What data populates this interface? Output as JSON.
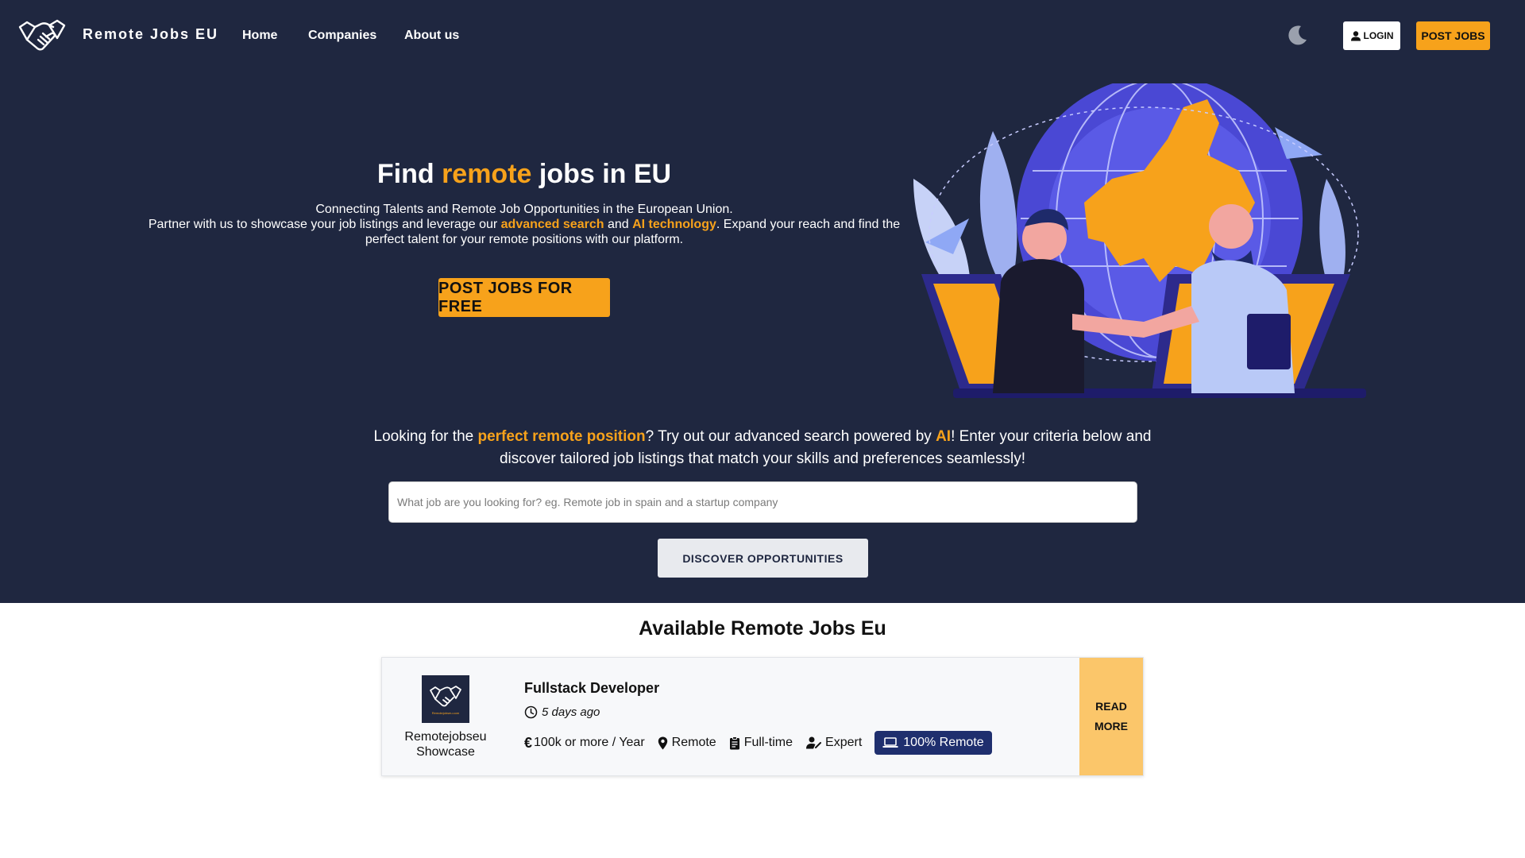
{
  "header": {
    "brand": "Remote Jobs EU",
    "nav": [
      "Home",
      "Companies",
      "About us"
    ],
    "login_label": "LOGIN",
    "post_jobs_label": "POST JOBS"
  },
  "hero": {
    "title_prefix": "Find ",
    "title_accent": "remote",
    "title_suffix": " jobs in EU",
    "sub_line1": "Connecting Talents and Remote Job Opportunities in the European Union.",
    "sub_line2_a": "Partner with us to showcase your job listings and leverage our ",
    "sub_line2_b": "advanced search",
    "sub_line2_c": " and ",
    "sub_line2_d": "AI technology",
    "sub_line2_e": ". Expand your reach and find the perfect talent for your remote positions with our platform.",
    "cta_label": "POST JOBS FOR FREE"
  },
  "search": {
    "intro_a": "Looking for the ",
    "intro_b": "perfect remote position",
    "intro_c": "? Try out our advanced search powered by ",
    "intro_d": "AI",
    "intro_e": "! Enter your criteria below and discover tailored job listings that match your skills and preferences seamlessly!",
    "placeholder": "What job are you looking for? eg. Remote job in spain and a startup company",
    "button_label": "DISCOVER OPPORTUNITIES"
  },
  "jobs": {
    "section_title": "Available Remote Jobs Eu",
    "items": [
      {
        "company": "Remotejobseu Showcase",
        "logo_text": "Remotejobseu.com",
        "title": "Fullstack Developer",
        "posted": "5 days ago",
        "salary": "100k or more / Year",
        "location": "Remote",
        "type": "Full-time",
        "level": "Expert",
        "remote_badge": "100% Remote",
        "read_more": "READ MORE"
      }
    ]
  },
  "colors": {
    "navy": "#1f2740",
    "accent": "#f7a21b",
    "read_more_bg": "#fbc66a",
    "badge": "#1f2f6e"
  },
  "icons": [
    "handshake-icon",
    "moon-icon",
    "user-icon",
    "globe-illustration",
    "clock-icon",
    "euro-icon",
    "location-pin-icon",
    "clipboard-icon",
    "user-expert-icon",
    "laptop-icon"
  ]
}
